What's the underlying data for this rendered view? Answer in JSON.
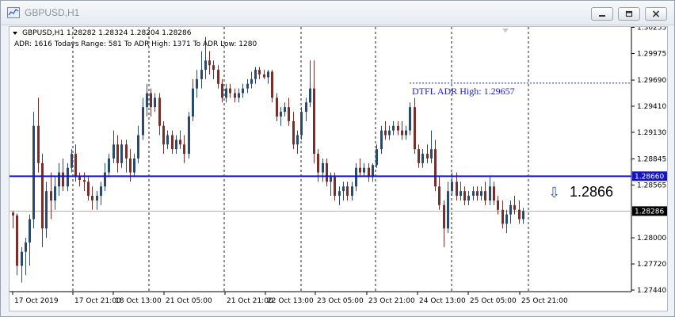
{
  "window": {
    "title": "GBPUSD,H1",
    "buttons": [
      "minimize",
      "restore",
      "close"
    ]
  },
  "chart_header": {
    "symbol_line": "GBPUSD,H1  1.28282 1.28324 1.28204 1.28286",
    "adr_line": "ADR: 1616  Todays Range: 581  To ADR High: 1371  To ADR Low: 1280"
  },
  "adr_high_label": "DTFL ADR High: 1.29657",
  "big_price_label": "1.2866",
  "price_axis": {
    "ticks": [
      "1.30255",
      "1.29975",
      "1.29690",
      "1.29410",
      "1.29130",
      "1.28845",
      "1.28565",
      "1.28286",
      "1.28000",
      "1.27720",
      "1.27440"
    ],
    "ticks_values": [
      1.30255,
      1.29975,
      1.2969,
      1.2941,
      1.2913,
      1.28845,
      1.28565,
      1.28286,
      1.28,
      1.2772,
      1.2744
    ],
    "hline_label": "1.28660",
    "current_label": "1.28286"
  },
  "time_axis": {
    "labels": [
      "17 Oct 2019",
      "17 Oct 21:00",
      "18 Oct 13:00",
      "21 Oct 05:00",
      "21 Oct 21:00",
      "22 Oct 13:00",
      "23 Oct 05:00",
      "23 Oct 21:00",
      "24 Oct 13:00",
      "25 Oct 05:00",
      "25 Oct 21:00"
    ]
  },
  "colors": {
    "bull": "#2b4a6f",
    "bear": "#7a2e2a",
    "hline": "#1515c8",
    "adr_line": "#1a1ae6",
    "current_line": "#b0b0b0",
    "grid": "#222222"
  },
  "chart_data": {
    "type": "candlestick",
    "symbol": "GBPUSD",
    "timeframe": "H1",
    "ylim": [
      1.2744,
      1.30255
    ],
    "hlines": [
      {
        "label": "1.28660",
        "value": 1.2866
      },
      {
        "label": "DTFL ADR High: 1.29657",
        "value": 1.29657
      }
    ],
    "current_price": 1.28286,
    "candles": [
      [
        1.2827,
        1.2829,
        1.281,
        1.2824
      ],
      [
        1.2824,
        1.2826,
        1.276,
        1.277
      ],
      [
        1.277,
        1.279,
        1.2752,
        1.2785
      ],
      [
        1.2785,
        1.28,
        1.276,
        1.2795
      ],
      [
        1.2795,
        1.2825,
        1.277,
        1.282
      ],
      [
        1.282,
        1.2935,
        1.281,
        1.292
      ],
      [
        1.292,
        1.295,
        1.287,
        1.288
      ],
      [
        1.288,
        1.289,
        1.279,
        1.281
      ],
      [
        1.281,
        1.286,
        1.28,
        1.285
      ],
      [
        1.285,
        1.287,
        1.282,
        1.284
      ],
      [
        1.284,
        1.2865,
        1.283,
        1.2855
      ],
      [
        1.2855,
        1.288,
        1.2845,
        1.287
      ],
      [
        1.287,
        1.2885,
        1.285,
        1.2855
      ],
      [
        1.2855,
        1.288,
        1.285,
        1.2875
      ],
      [
        1.2875,
        1.2895,
        1.287,
        1.289
      ],
      [
        1.289,
        1.29,
        1.286,
        1.2865
      ],
      [
        1.2865,
        1.287,
        1.2855,
        1.2862
      ],
      [
        1.2862,
        1.287,
        1.285,
        1.286
      ],
      [
        1.286,
        1.2865,
        1.284,
        1.2845
      ],
      [
        1.2845,
        1.2855,
        1.283,
        1.284
      ],
      [
        1.284,
        1.285,
        1.283,
        1.2845
      ],
      [
        1.2845,
        1.286,
        1.2835,
        1.2855
      ],
      [
        1.2855,
        1.288,
        1.285,
        1.287
      ],
      [
        1.287,
        1.289,
        1.2865,
        1.2885
      ],
      [
        1.2885,
        1.2915,
        1.288,
        1.29
      ],
      [
        1.29,
        1.291,
        1.287,
        1.288
      ],
      [
        1.288,
        1.2905,
        1.2875,
        1.29
      ],
      [
        1.29,
        1.2905,
        1.287,
        1.2885
      ],
      [
        1.2885,
        1.2895,
        1.286,
        1.287
      ],
      [
        1.287,
        1.289,
        1.2865,
        1.2885
      ],
      [
        1.2885,
        1.292,
        1.288,
        1.291
      ],
      [
        1.291,
        1.295,
        1.2905,
        1.294
      ],
      [
        1.294,
        1.2965,
        1.293,
        1.2955
      ],
      [
        1.2955,
        1.296,
        1.293,
        1.294
      ],
      [
        1.294,
        1.2955,
        1.2935,
        1.295
      ],
      [
        1.295,
        1.2955,
        1.291,
        1.292
      ],
      [
        1.292,
        1.2925,
        1.289,
        1.29
      ],
      [
        1.29,
        1.2915,
        1.2895,
        1.291
      ],
      [
        1.291,
        1.2915,
        1.289,
        1.2895
      ],
      [
        1.2895,
        1.291,
        1.289,
        1.2905
      ],
      [
        1.2905,
        1.2915,
        1.2895,
        1.29
      ],
      [
        1.29,
        1.291,
        1.288,
        1.289
      ],
      [
        1.289,
        1.2935,
        1.2885,
        1.293
      ],
      [
        1.293,
        1.297,
        1.2925,
        1.296
      ],
      [
        1.296,
        1.298,
        1.295,
        1.297
      ],
      [
        1.297,
        1.3,
        1.296,
        1.298
      ],
      [
        1.298,
        1.3015,
        1.297,
        1.299
      ],
      [
        1.299,
        1.3,
        1.2975,
        1.2985
      ],
      [
        1.2985,
        1.299,
        1.297,
        1.298
      ],
      [
        1.298,
        1.2985,
        1.296,
        1.2965
      ],
      [
        1.2965,
        1.297,
        1.2945,
        1.295
      ],
      [
        1.295,
        1.2965,
        1.2945,
        1.296
      ],
      [
        1.296,
        1.2965,
        1.295,
        1.2955
      ],
      [
        1.2955,
        1.296,
        1.2945,
        1.295
      ],
      [
        1.295,
        1.296,
        1.2945,
        1.2955
      ],
      [
        1.2955,
        1.2965,
        1.295,
        1.296
      ],
      [
        1.296,
        1.297,
        1.2955,
        1.2965
      ],
      [
        1.2965,
        1.2978,
        1.296,
        1.297
      ],
      [
        1.297,
        1.2983,
        1.2965,
        1.298
      ],
      [
        1.298,
        1.2983,
        1.297,
        1.2975
      ],
      [
        1.2975,
        1.298,
        1.297,
        1.2972
      ],
      [
        1.2972,
        1.298,
        1.2965,
        1.2978
      ],
      [
        1.2978,
        1.298,
        1.2945,
        1.295
      ],
      [
        1.295,
        1.2955,
        1.2925,
        1.293
      ],
      [
        1.293,
        1.294,
        1.292,
        1.2935
      ],
      [
        1.2935,
        1.2945,
        1.293,
        1.294
      ],
      [
        1.294,
        1.295,
        1.292,
        1.2925
      ],
      [
        1.2925,
        1.2935,
        1.2895,
        1.29
      ],
      [
        1.29,
        1.2915,
        1.289,
        1.291
      ],
      [
        1.291,
        1.294,
        1.2905,
        1.2935
      ],
      [
        1.2935,
        1.295,
        1.2925,
        1.2945
      ],
      [
        1.2945,
        1.299,
        1.294,
        1.296
      ],
      [
        1.296,
        1.299,
        1.288,
        1.289
      ],
      [
        1.289,
        1.2895,
        1.286,
        1.287
      ],
      [
        1.287,
        1.2885,
        1.286,
        1.288
      ],
      [
        1.288,
        1.2885,
        1.2855,
        1.286
      ],
      [
        1.286,
        1.287,
        1.2845,
        1.2865
      ],
      [
        1.2865,
        1.287,
        1.284,
        1.2845
      ],
      [
        1.2845,
        1.2855,
        1.2835,
        1.285
      ],
      [
        1.285,
        1.286,
        1.284,
        1.2855
      ],
      [
        1.2855,
        1.286,
        1.284,
        1.2845
      ],
      [
        1.2845,
        1.286,
        1.284,
        1.2855
      ],
      [
        1.2855,
        1.288,
        1.285,
        1.2875
      ],
      [
        1.2875,
        1.2885,
        1.2865,
        1.287
      ],
      [
        1.287,
        1.288,
        1.2865,
        1.2875
      ],
      [
        1.2875,
        1.288,
        1.286,
        1.2865
      ],
      [
        1.2865,
        1.288,
        1.286,
        1.2878
      ],
      [
        1.2878,
        1.29,
        1.2875,
        1.2895
      ],
      [
        1.2895,
        1.292,
        1.289,
        1.2915
      ],
      [
        1.2915,
        1.2925,
        1.2905,
        1.291
      ],
      [
        1.291,
        1.292,
        1.2905,
        1.2915
      ],
      [
        1.2915,
        1.2925,
        1.291,
        1.292
      ],
      [
        1.292,
        1.2925,
        1.291,
        1.2915
      ],
      [
        1.2915,
        1.2925,
        1.2905,
        1.291
      ],
      [
        1.291,
        1.292,
        1.2905,
        1.2915
      ],
      [
        1.2915,
        1.2945,
        1.291,
        1.294
      ],
      [
        1.294,
        1.295,
        1.289,
        1.2895
      ],
      [
        1.2895,
        1.29,
        1.2875,
        1.288
      ],
      [
        1.288,
        1.2895,
        1.2875,
        1.289
      ],
      [
        1.289,
        1.29,
        1.288,
        1.2885
      ],
      [
        1.2885,
        1.2915,
        1.288,
        1.2895
      ],
      [
        1.2895,
        1.2905,
        1.285,
        1.2855
      ],
      [
        1.2855,
        1.2865,
        1.283,
        1.2835
      ],
      [
        1.2835,
        1.284,
        1.279,
        1.281
      ],
      [
        1.281,
        1.286,
        1.2805,
        1.285
      ],
      [
        1.285,
        1.287,
        1.2845,
        1.286
      ],
      [
        1.286,
        1.287,
        1.284,
        1.2845
      ],
      [
        1.2845,
        1.286,
        1.284,
        1.285
      ],
      [
        1.285,
        1.2855,
        1.2835,
        1.284
      ],
      [
        1.284,
        1.285,
        1.2835,
        1.2845
      ],
      [
        1.2845,
        1.2855,
        1.284,
        1.285
      ],
      [
        1.285,
        1.2855,
        1.284,
        1.2845
      ],
      [
        1.2845,
        1.2855,
        1.284,
        1.285
      ],
      [
        1.285,
        1.286,
        1.2835,
        1.284
      ],
      [
        1.284,
        1.2865,
        1.2835,
        1.2855
      ],
      [
        1.2855,
        1.286,
        1.2835,
        1.284
      ],
      [
        1.284,
        1.2845,
        1.2825,
        1.283
      ],
      [
        1.283,
        1.284,
        1.281,
        1.2815
      ],
      [
        1.2815,
        1.283,
        1.2805,
        1.2825
      ],
      [
        1.2825,
        1.284,
        1.2815,
        1.2835
      ],
      [
        1.2835,
        1.2845,
        1.2825,
        1.283
      ],
      [
        1.283,
        1.284,
        1.2815,
        1.282
      ],
      [
        1.282,
        1.2832,
        1.2815,
        1.28286
      ]
    ]
  }
}
